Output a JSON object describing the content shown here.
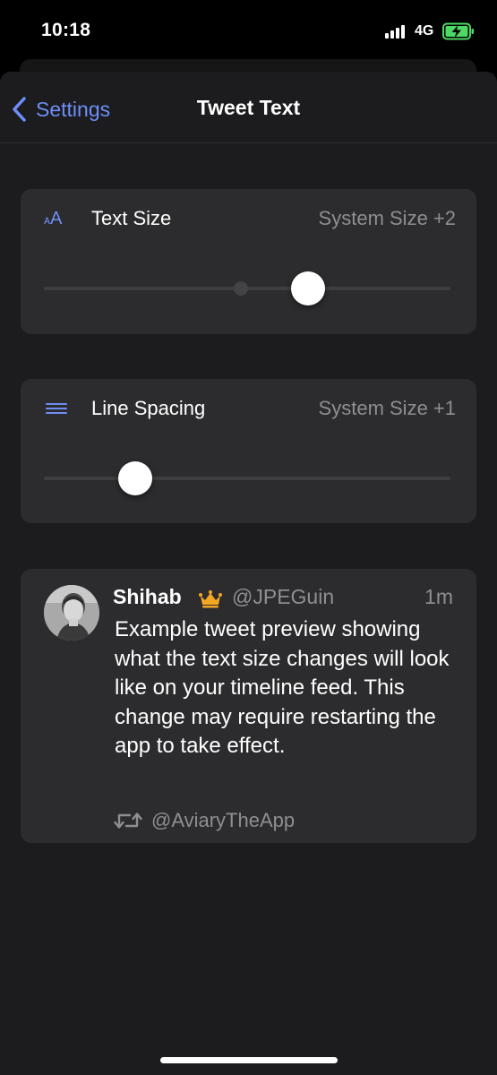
{
  "status_bar": {
    "time": "10:18",
    "network": "4G",
    "battery_color": "#4cd964",
    "battery_level": 0.85,
    "charging": true
  },
  "nav": {
    "back_label": "Settings",
    "title": "Tweet Text",
    "accent_color": "#6e8ef7"
  },
  "text_size": {
    "icon": "text-size-icon",
    "label": "Text Size",
    "value": "System Size +2",
    "slider_fraction": 0.65,
    "tick_fraction": 0.485
  },
  "line_spacing": {
    "icon": "line-spacing-icon",
    "label": "Line Spacing",
    "value": "System Size +1",
    "slider_fraction": 0.225
  },
  "tweet_preview": {
    "name": "Shihab",
    "badge_icon": "crown-icon",
    "handle": "@JPEGuin",
    "time": "1m",
    "body": "Example tweet preview showing what the text size changes will look like on your timeline feed. This change may require restarting the app to take effect.",
    "retweet_icon": "retweet-icon",
    "retweeted_by": "@AviaryTheApp"
  }
}
